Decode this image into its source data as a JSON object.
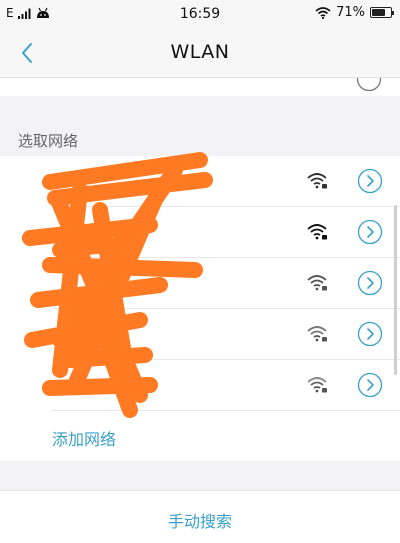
{
  "status_bar": {
    "carrier": "E",
    "time": "16:59",
    "battery_percent": "71%",
    "battery_level": 0.71
  },
  "nav": {
    "title": "WLAN"
  },
  "section": {
    "label": "选取网络"
  },
  "networks": [
    {
      "name": ""
    },
    {
      "name": ""
    },
    {
      "name": ""
    },
    {
      "name": ""
    },
    {
      "name": ""
    }
  ],
  "actions": {
    "add_network": "添加网络",
    "manual_search": "手动搜索"
  },
  "colors": {
    "accent": "#3aa0c8",
    "redaction": "#ff7a22"
  },
  "icons": {
    "back": "chevron-left-icon",
    "wifi_locked": "wifi-lock-icon",
    "info": "chevron-right-circle-icon"
  }
}
